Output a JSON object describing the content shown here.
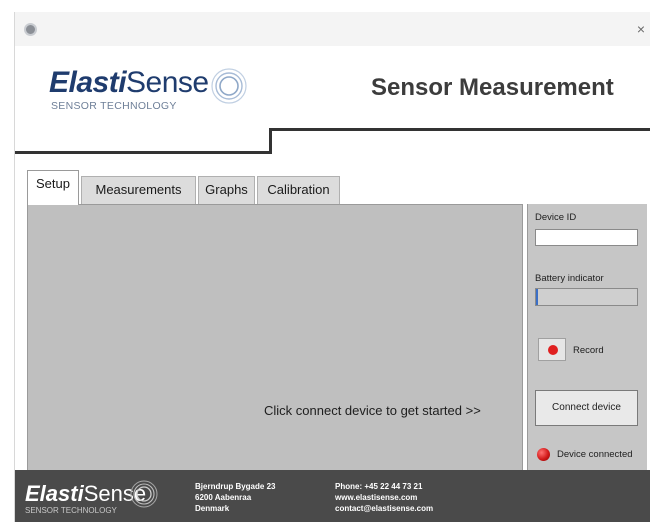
{
  "header": {
    "logo_bold": "Elasti",
    "logo_thin": "Sense",
    "logo_tagline": "SENSOR TECHNOLOGY",
    "title": "Sensor Measurement"
  },
  "titlebar": {
    "close_glyph": "×"
  },
  "tabs": [
    {
      "label": "Setup",
      "active": true
    },
    {
      "label": "Measurements",
      "active": false
    },
    {
      "label": "Graphs",
      "active": false
    },
    {
      "label": "Calibration",
      "active": false
    }
  ],
  "main": {
    "hint": "Click connect device to get started >>"
  },
  "side": {
    "device_id_label": "Device ID",
    "device_id_value": "",
    "battery_label": "Battery indicator",
    "battery_level_percent": 2,
    "record_label": "Record",
    "connect_label": "Connect device",
    "status_label": "Device connected"
  },
  "footer": {
    "logo_bold": "Elasti",
    "logo_thin": "Sense",
    "logo_tagline": "SENSOR TECHNOLOGY",
    "address": [
      "Bjerndrup Bygade 23",
      "6200 Aabenraa",
      "Denmark"
    ],
    "contact": [
      "Phone: +45 22 44 73 21",
      "www.elastisense.com",
      "contact@elastisense.com"
    ]
  },
  "colors": {
    "brand_navy": "#1f3c6e",
    "panel_gray": "#bfbfbf",
    "footer_dark": "#4a4a4a",
    "status_red": "#d21a1a",
    "battery_blue": "#3b6fc6"
  },
  "icons": [
    "app-icon",
    "close-icon",
    "logo-rings-icon",
    "record-icon",
    "status-led-icon"
  ]
}
